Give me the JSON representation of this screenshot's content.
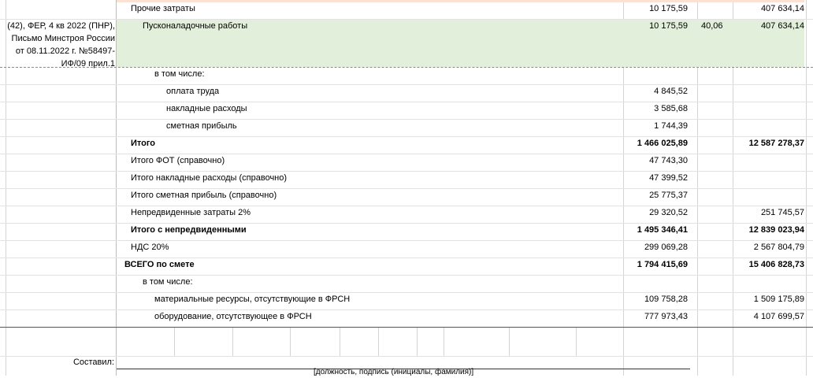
{
  "reference": [
    "(42), ФЕР, 4 кв 2022 (ПНР),",
    "Письмо Минстроя России",
    "от 08.11.2022 г. №58497-",
    "ИФ/09 прил.1"
  ],
  "rows": [
    {
      "label": "Прочие затраты",
      "value": "10 175,59",
      "coef": "",
      "total": "407 634,14"
    },
    {
      "label": "Пусконаладочные работы",
      "value": "10 175,59",
      "coef": "40,06",
      "total": "407 634,14"
    },
    {
      "label": "в том числе:",
      "value": "",
      "coef": "",
      "total": ""
    },
    {
      "label": "оплата труда",
      "value": "4 845,52",
      "coef": "",
      "total": ""
    },
    {
      "label": "накладные расходы",
      "value": "3 585,68",
      "coef": "",
      "total": ""
    },
    {
      "label": "сметная прибыль",
      "value": "1 744,39",
      "coef": "",
      "total": ""
    },
    {
      "label": "Итого",
      "value": "1 466 025,89",
      "coef": "",
      "total": "12 587 278,37"
    },
    {
      "label": "Итого ФОТ (справочно)",
      "value": "47 743,30",
      "coef": "",
      "total": ""
    },
    {
      "label": "Итого накладные расходы (справочно)",
      "value": "47 399,52",
      "coef": "",
      "total": ""
    },
    {
      "label": "Итого сметная прибыль (справочно)",
      "value": "25 775,37",
      "coef": "",
      "total": ""
    },
    {
      "label": "Непредвиденные затраты 2%",
      "value": "29 320,52",
      "coef": "",
      "total": "251 745,57"
    },
    {
      "label": "Итого с непредвиденными",
      "value": "1 495 346,41",
      "coef": "",
      "total": "12 839 023,94"
    },
    {
      "label": "НДС 20%",
      "value": "299 069,28",
      "coef": "",
      "total": "2 567 804,79"
    },
    {
      "label": "ВСЕГО по смете",
      "value": "1 794 415,69",
      "coef": "",
      "total": "15 406 828,73"
    },
    {
      "label": "в том числе:",
      "value": "",
      "coef": "",
      "total": ""
    },
    {
      "label": "материальные ресурсы, отсутствующие в ФРСН",
      "value": "109 758,28",
      "coef": "",
      "total": "1 509 175,89"
    },
    {
      "label": "оборудование, отсутствующее в ФРСН",
      "value": "777 973,43",
      "coef": "",
      "total": "4 107 699,57"
    }
  ],
  "footer": {
    "composed_label": "Составил:",
    "signature_caption": "[должность, подпись (инициалы, фамилия)]"
  }
}
